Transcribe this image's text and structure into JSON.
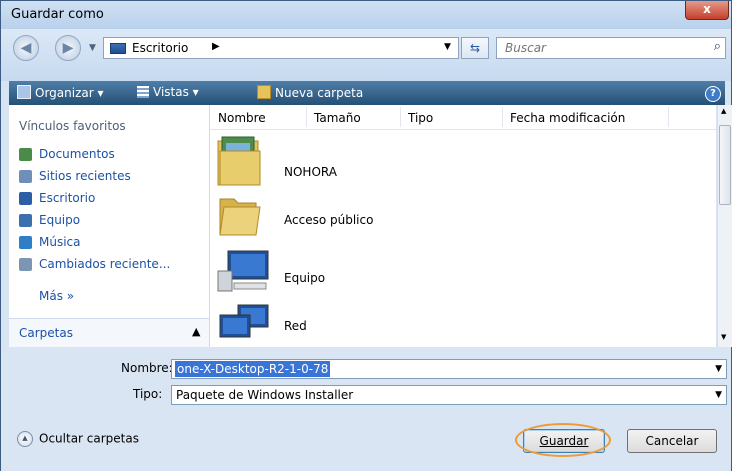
{
  "window": {
    "title": "Guardar como",
    "close_label": "x"
  },
  "nav": {
    "back_icon": "back-arrow-icon",
    "forward_icon": "forward-arrow-icon",
    "breadcrumb": "Escritorio",
    "search_placeholder": "Buscar"
  },
  "toolbar": {
    "organize": "Organizar",
    "views": "Vistas",
    "new_folder": "Nueva carpeta"
  },
  "sidebar": {
    "favorites_title": "Vínculos favoritos",
    "items": [
      {
        "label": "Documentos",
        "icon": "documents-icon",
        "color": "#4b8b4a"
      },
      {
        "label": "Sitios recientes",
        "icon": "recent-places-icon",
        "color": "#6f8fb8"
      },
      {
        "label": "Escritorio",
        "icon": "desktop-icon",
        "color": "#2c5ea8"
      },
      {
        "label": "Equipo",
        "icon": "computer-icon",
        "color": "#3b6fb0"
      },
      {
        "label": "Música",
        "icon": "music-icon",
        "color": "#2f7fc8"
      },
      {
        "label": "Cambiados reciente...",
        "icon": "recently-changed-icon",
        "color": "#7c95b3"
      }
    ],
    "more": "Más »",
    "folders_label": "Carpetas"
  },
  "columns": [
    "Nombre",
    "Tamaño",
    "Tipo",
    "Fecha modificación"
  ],
  "files": [
    {
      "name": "NOHORA",
      "icon": "user-folder-icon"
    },
    {
      "name": "Acceso público",
      "icon": "folder-icon"
    },
    {
      "name": "Equipo",
      "icon": "computer-icon"
    },
    {
      "name": "Red",
      "icon": "network-icon"
    }
  ],
  "form": {
    "name_label": "Nombre:",
    "name_value": "one-X-Desktop-R2-1-0-78",
    "type_label": "Tipo:",
    "type_value": "Paquete de Windows Installer"
  },
  "footer": {
    "hide_folders": "Ocultar carpetas",
    "save": "Guardar",
    "cancel": "Cancelar"
  }
}
